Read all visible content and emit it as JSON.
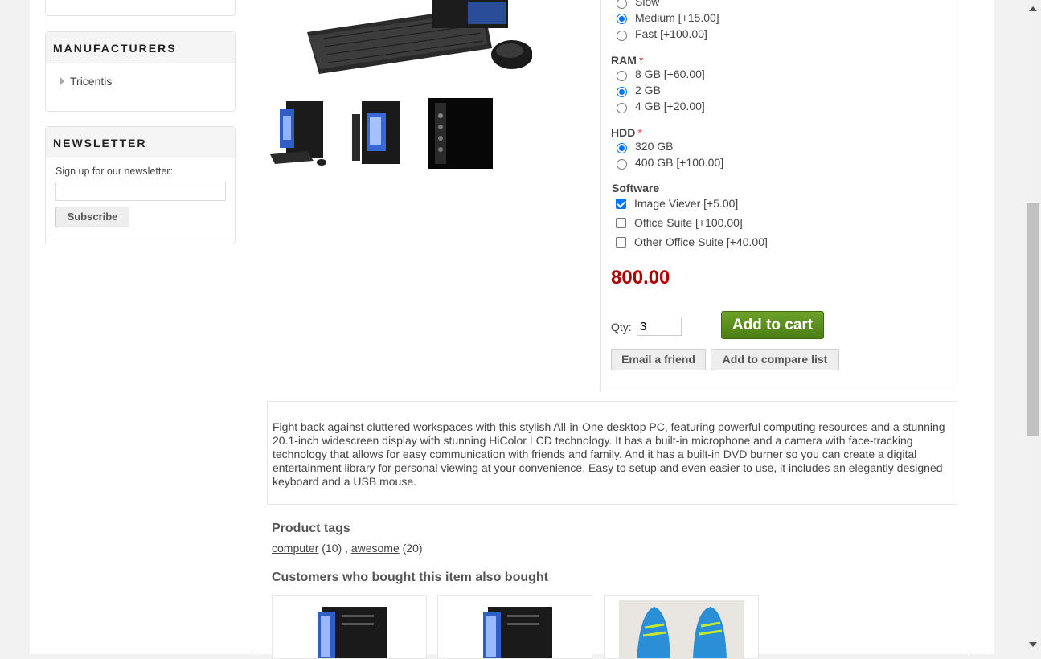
{
  "sidebar": {
    "manufacturers": {
      "title": "MANUFACTURERS",
      "items": [
        "Tricentis"
      ]
    },
    "newsletter": {
      "title": "NEWSLETTER",
      "label": "Sign up for our newsletter:",
      "input_value": "",
      "button": "Subscribe"
    }
  },
  "options": {
    "processor": {
      "items": [
        {
          "label": "Slow",
          "checked": false
        },
        {
          "label": "Medium [+15.00]",
          "checked": true
        },
        {
          "label": "Fast [+100.00]",
          "checked": false
        }
      ]
    },
    "ram": {
      "title": "RAM",
      "required": "*",
      "items": [
        {
          "label": "8 GB [+60.00]",
          "checked": false
        },
        {
          "label": "2 GB",
          "checked": true
        },
        {
          "label": "4 GB [+20.00]",
          "checked": false
        }
      ]
    },
    "hdd": {
      "title": "HDD",
      "required": "*",
      "items": [
        {
          "label": "320 GB",
          "checked": true
        },
        {
          "label": "400 GB [+100.00]",
          "checked": false
        }
      ]
    },
    "software": {
      "title": "Software",
      "items": [
        {
          "label": "Image Viever [+5.00]",
          "checked": true
        },
        {
          "label": "Office Suite [+100.00]",
          "checked": false
        },
        {
          "label": "Other Office Suite [+40.00]",
          "checked": false
        }
      ]
    }
  },
  "price": "800.00",
  "qty": {
    "label": "Qty:",
    "value": "3"
  },
  "buttons": {
    "add_to_cart": "Add to cart",
    "email_friend": "Email a friend",
    "compare": "Add to compare list"
  },
  "description": "Fight back against cluttered workspaces with this stylish All-in-One desktop PC, featuring powerful computing resources and a stunning 20.1-inch widescreen display with stunning HiColor LCD technology. It has a built-in microphone and a camera with face-tracking technology that allows for easy communication with friends and family. And it has a built-in DVD burner so you can create a digital entertainment library for personal viewing at your convenience. Easy to setup and even easier to use, it includes an elegantly designed keyboard and a USB mouse.",
  "tags": {
    "title": "Product tags",
    "items": [
      {
        "name": "computer",
        "count": "(10)"
      },
      {
        "name": "awesome",
        "count": "(20)"
      }
    ],
    "separator": ","
  },
  "also_bought": {
    "title": "Customers who bought this item also bought"
  },
  "colors": {
    "price": "#b00000",
    "cart_green": "#5a8f1f",
    "accent_blue": "#0075ff"
  }
}
